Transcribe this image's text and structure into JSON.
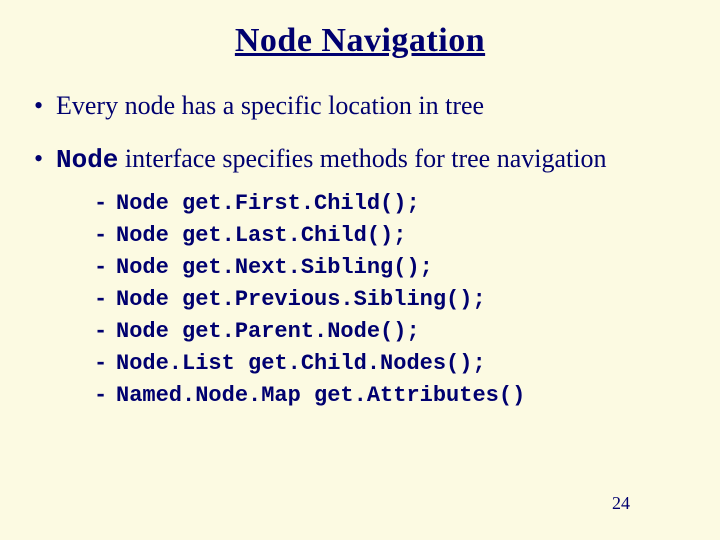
{
  "slide": {
    "title": "Node Navigation",
    "bullet1": "Every node has a specific location in tree",
    "bullet2_codeword": "Node",
    "bullet2_rest": " interface specifies methods for tree navigation",
    "methods": [
      "Node get.First.Child();",
      "Node get.Last.Child();",
      "Node get.Next.Sibling();",
      "Node get.Previous.Sibling();",
      "Node get.Parent.Node();",
      "Node.List get.Child.Nodes();",
      "Named.Node.Map get.Attributes()"
    ],
    "page_number": "24"
  }
}
